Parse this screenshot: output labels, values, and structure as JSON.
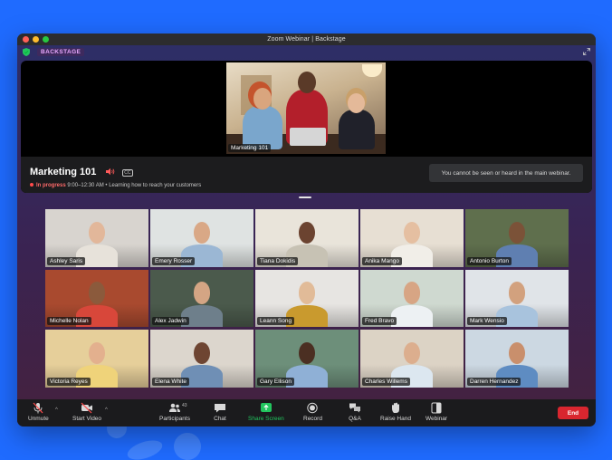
{
  "window": {
    "title": "Zoom Webinar | Backstage"
  },
  "backstage": {
    "label": "BACKSTAGE"
  },
  "stage": {
    "main_video_name": "Marketing 101",
    "session_title": "Marketing 101",
    "cc_label": "CC",
    "status": "In progress",
    "time": "9:00–12:30 AM",
    "separator": "•",
    "description": "Learning how to reach your customers",
    "notice": "You cannot be seen or heard in the main webinar."
  },
  "participants": [
    {
      "name": "Ashley Saris",
      "bg": "#d8d4cf",
      "shirt": "#e7e2da",
      "skin": "#e2b79a"
    },
    {
      "name": "Emery Rosser",
      "bg": "#dfe3e2",
      "shirt": "#9bb7d4",
      "skin": "#d9a886"
    },
    {
      "name": "Tiana Dokidis",
      "bg": "#e9e4da",
      "shirt": "#c7c2b4",
      "skin": "#6b4330"
    },
    {
      "name": "Anika Mango",
      "bg": "#e7dfd3",
      "shirt": "#f1eee8",
      "skin": "#e5bfa1"
    },
    {
      "name": "Antonio Burton",
      "bg": "#5f6f4d",
      "shirt": "#5f7fb1",
      "skin": "#7b5238"
    },
    {
      "name": "Michelle Nolan",
      "bg": "#a94a2f",
      "shirt": "#d8473a",
      "skin": "#8b5a3c"
    },
    {
      "name": "Alex Jadwin",
      "bg": "#4b5a4c",
      "shirt": "#6e7f8b",
      "skin": "#d4a584"
    },
    {
      "name": "Leann Song",
      "bg": "#e7e5e2",
      "shirt": "#c99a2e",
      "skin": "#e1bb98"
    },
    {
      "name": "Fred Bravo",
      "bg": "#cfd9d0",
      "shirt": "#edf1f3",
      "skin": "#d7a584"
    },
    {
      "name": "Mark Wensio",
      "bg": "#e0e4e8",
      "shirt": "#a8c3dd",
      "skin": "#d2a17e"
    },
    {
      "name": "Victoria Reyes",
      "bg": "#e6cf9a",
      "shirt": "#efd37a",
      "skin": "#e3b08e"
    },
    {
      "name": "Elena White",
      "bg": "#dcd6cd",
      "shirt": "#6f8fb5",
      "skin": "#6e4532"
    },
    {
      "name": "Gary Ellison",
      "bg": "#6d8f7a",
      "shirt": "#8fb0d6",
      "skin": "#4b2f22"
    },
    {
      "name": "Charles Willems",
      "bg": "#dcd3c5",
      "shirt": "#dce7f0",
      "skin": "#dcae8e"
    },
    {
      "name": "Darren Hernandez",
      "bg": "#ccd8e2",
      "shirt": "#5e8cc2",
      "skin": "#c98f6c"
    }
  ],
  "toolbar": {
    "unmute": "Unmute",
    "start_video": "Start Video",
    "participants": "Participants",
    "participants_count": "43",
    "chat": "Chat",
    "share_screen": "Share Screen",
    "record": "Record",
    "qa": "Q&A",
    "raise_hand": "Raise Hand",
    "webinar": "Webinar",
    "end": "End"
  },
  "colors": {
    "accent_green": "#22c55e",
    "end_red": "#d9262f",
    "page_bg": "#1f6bff"
  }
}
